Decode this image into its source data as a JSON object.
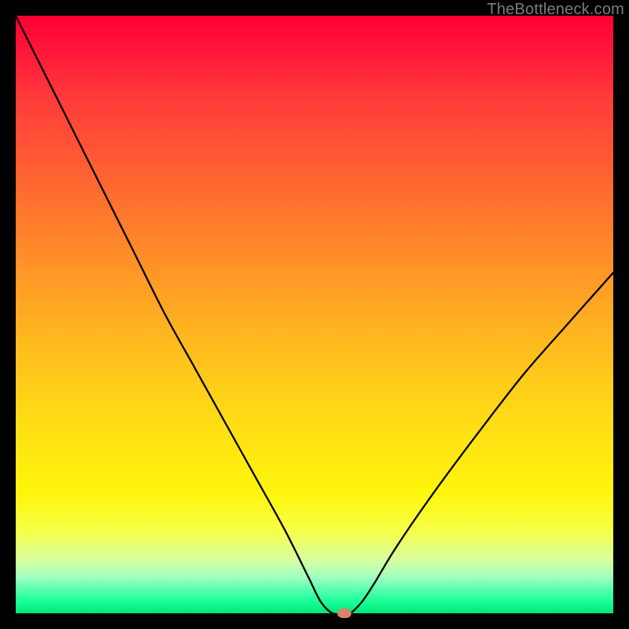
{
  "attribution": "TheBottleneck.com",
  "chart_data": {
    "type": "line",
    "title": "",
    "xlabel": "",
    "ylabel": "",
    "xlim": [
      0,
      100
    ],
    "ylim": [
      0,
      100
    ],
    "grid": false,
    "legend": false,
    "background": "rainbow-vertical",
    "series": [
      {
        "name": "bottleneck-curve",
        "x": [
          0,
          5,
          10,
          15,
          20,
          25,
          30,
          35,
          40,
          45,
          49,
          51,
          53,
          55,
          56,
          58,
          60,
          63,
          67,
          72,
          78,
          85,
          92,
          100
        ],
        "values": [
          100,
          90,
          80,
          70,
          60,
          50,
          41,
          32,
          23,
          14,
          6,
          2,
          0,
          0,
          0,
          2,
          5,
          10,
          16,
          23,
          31,
          40,
          48,
          57
        ]
      }
    ],
    "marker": {
      "x": 55,
      "y": 0,
      "color": "#d9836b"
    },
    "colors": {
      "curve": "#000000",
      "gradient_top": "#ff0033",
      "gradient_mid": "#ffe512",
      "gradient_bottom": "#00e878"
    }
  }
}
